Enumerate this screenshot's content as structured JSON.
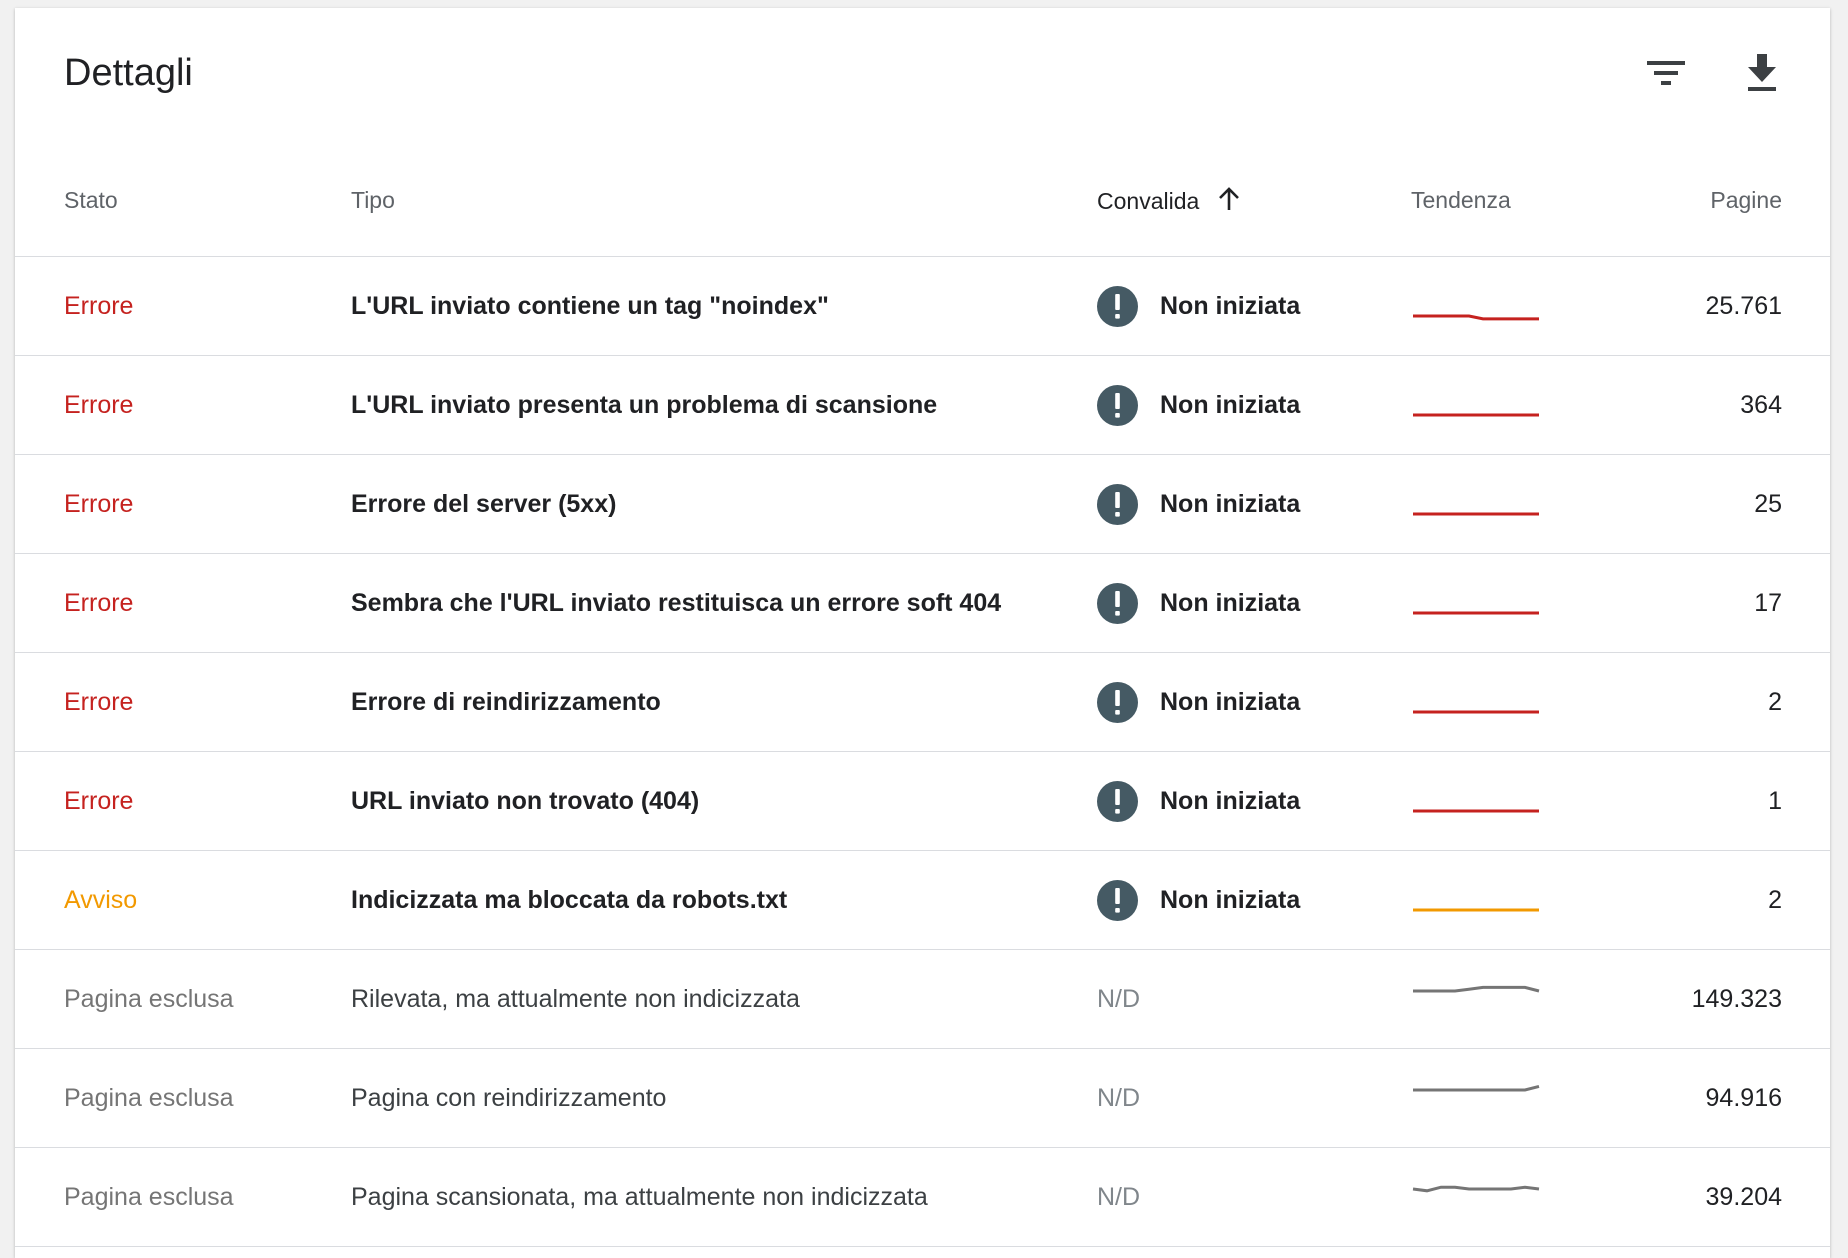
{
  "title": "Dettagli",
  "toolbar": {
    "filter_icon": "filter-list-icon",
    "download_icon": "download-icon"
  },
  "columns": {
    "status": "Stato",
    "type": "Tipo",
    "validation": "Convalida",
    "trend": "Tendenza",
    "pages": "Pagine",
    "sort_icon": "arrow-upward-icon"
  },
  "colors": {
    "error": "#c5221f",
    "warning": "#f29900",
    "excluded": "#757575",
    "icon_dark": "#455a64"
  },
  "rows": [
    {
      "status": "Errore",
      "kind": "error",
      "type": "L'URL inviato contiene un tag \"noindex\"",
      "validation": "Non iniziata",
      "validation_icon": "exclamation-icon",
      "pages": "25.761",
      "trend": [
        0.5,
        0.5,
        0.5,
        0.5,
        0.5,
        0.42,
        0.42,
        0.42,
        0.42,
        0.42
      ]
    },
    {
      "status": "Errore",
      "kind": "error",
      "type": "L'URL inviato presenta un problema di scansione",
      "validation": "Non iniziata",
      "validation_icon": "exclamation-icon",
      "pages": "364",
      "trend": [
        0.5,
        0.5,
        0.5,
        0.5,
        0.5,
        0.5,
        0.5,
        0.5,
        0.5,
        0.5
      ]
    },
    {
      "status": "Errore",
      "kind": "error",
      "type": "Errore del server (5xx)",
      "validation": "Non iniziata",
      "validation_icon": "exclamation-icon",
      "pages": "25",
      "trend": [
        0.5,
        0.5,
        0.5,
        0.5,
        0.5,
        0.5,
        0.5,
        0.5,
        0.5,
        0.5
      ]
    },
    {
      "status": "Errore",
      "kind": "error",
      "type": "Sembra che l'URL inviato restituisca un errore soft 404",
      "validation": "Non iniziata",
      "validation_icon": "exclamation-icon",
      "pages": "17",
      "trend": [
        0.5,
        0.5,
        0.5,
        0.5,
        0.5,
        0.5,
        0.5,
        0.5,
        0.5,
        0.5
      ]
    },
    {
      "status": "Errore",
      "kind": "error",
      "type": "Errore di reindirizzamento",
      "validation": "Non iniziata",
      "validation_icon": "exclamation-icon",
      "pages": "2",
      "trend": [
        0.5,
        0.5,
        0.5,
        0.5,
        0.5,
        0.5,
        0.5,
        0.5,
        0.5,
        0.5
      ]
    },
    {
      "status": "Errore",
      "kind": "error",
      "type": "URL inviato non trovato (404)",
      "validation": "Non iniziata",
      "validation_icon": "exclamation-icon",
      "pages": "1",
      "trend": [
        0.5,
        0.5,
        0.5,
        0.5,
        0.5,
        0.5,
        0.5,
        0.5,
        0.5,
        0.5
      ]
    },
    {
      "status": "Avviso",
      "kind": "warning",
      "type": "Indicizzata ma bloccata da robots.txt",
      "validation": "Non iniziata",
      "validation_icon": "exclamation-icon",
      "pages": "2",
      "trend": [
        0.5,
        0.5,
        0.5,
        0.5,
        0.5,
        0.5,
        0.5,
        0.5,
        0.5,
        0.5
      ]
    },
    {
      "status": "Pagina esclusa",
      "kind": "excluded",
      "type": "Rilevata, ma attualmente non indicizzata",
      "validation": "N/D",
      "validation_icon": "",
      "pages": "149.323",
      "trend": [
        0.5,
        0.5,
        0.5,
        0.5,
        0.55,
        0.6,
        0.6,
        0.6,
        0.6,
        0.5
      ]
    },
    {
      "status": "Pagina esclusa",
      "kind": "excluded",
      "type": "Pagina con reindirizzamento",
      "validation": "N/D",
      "validation_icon": "",
      "pages": "94.916",
      "trend": [
        0.5,
        0.5,
        0.5,
        0.5,
        0.5,
        0.5,
        0.5,
        0.5,
        0.5,
        0.6
      ]
    },
    {
      "status": "Pagina esclusa",
      "kind": "excluded",
      "type": "Pagina scansionata, ma attualmente non indicizzata",
      "validation": "N/D",
      "validation_icon": "",
      "pages": "39.204",
      "trend": [
        0.5,
        0.45,
        0.55,
        0.55,
        0.5,
        0.5,
        0.5,
        0.5,
        0.55,
        0.5
      ]
    }
  ]
}
